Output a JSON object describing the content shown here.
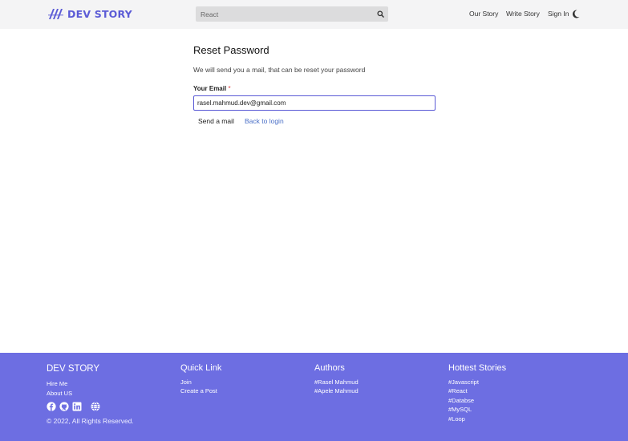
{
  "header": {
    "brand": "DEV STORY",
    "search_value": "React",
    "nav": [
      "Our Story",
      "Write Story",
      "Sign In"
    ]
  },
  "main": {
    "title": "Reset Password",
    "subtitle": "We will send you a mail, that can be reset your password",
    "email_label": "Your Email",
    "required_mark": "*",
    "email_value": "rasel.mahmud.dev@gmail.com",
    "send_button": "Send a mail",
    "back_link": "Back to login"
  },
  "footer": {
    "brand": "DEV STORY",
    "brand_links": [
      "Hire Me",
      "About US"
    ],
    "quick_link_title": "Quick Link",
    "quick_links": [
      "Join",
      "Create a Post"
    ],
    "authors_title": "Authors",
    "authors": [
      "#Rasel Mahmud",
      "#Apele Mahmud"
    ],
    "hottest_title": "Hottest Stories",
    "hottest": [
      "#Javascript",
      "#React",
      "#Databse",
      "#MySQL",
      "#Loop"
    ],
    "social_icons": [
      "facebook-icon",
      "github-icon",
      "linkedin-icon",
      "globe-icon"
    ],
    "copyright": "© 2022, All Rights Reserved."
  },
  "colors": {
    "brand": "#5b5bd6",
    "footer_bg": "#6d6ee2",
    "header_bg": "#f4f4f5",
    "link": "#4a6fc7"
  }
}
